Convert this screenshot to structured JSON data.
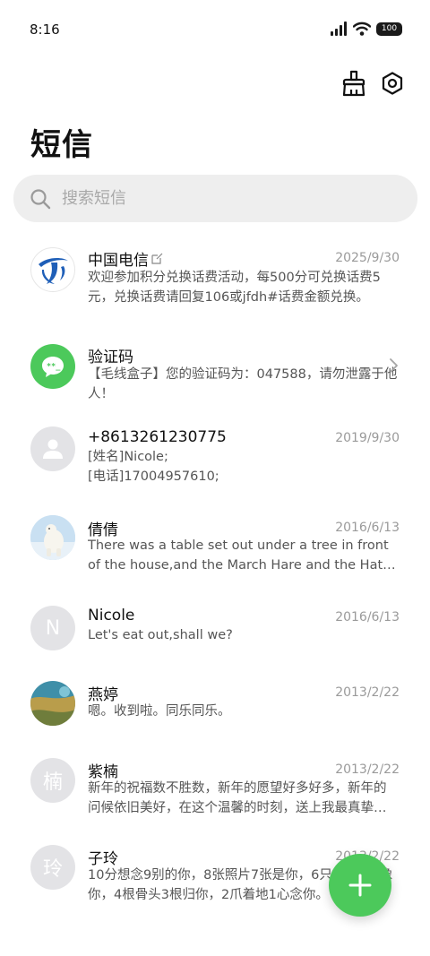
{
  "status_bar": {
    "time": "8:16",
    "battery": "100",
    "icons": [
      "signal-icon",
      "wifi-icon",
      "battery-icon"
    ]
  },
  "toolbar": {
    "icons": [
      "brush-icon",
      "settings-icon"
    ]
  },
  "page": {
    "title": "短信"
  },
  "search": {
    "placeholder": "搜索短信",
    "value": ""
  },
  "threads": [
    {
      "sender": "中国电信",
      "date": "2025/9/30",
      "preview": "欢迎参加积分兑换话费活动，每500分可兑换话费5元，兑换话费请回复106或jfdh#话费金额兑换。",
      "avatar": "china-telecom-logo"
    },
    {
      "sender": "验证码",
      "date": "",
      "preview": "【毛线盒子】您的验证码为：047588，请勿泄露于他人！",
      "avatar": "verification-code-icon"
    },
    {
      "sender": "+8613261230775",
      "date": "2019/9/30",
      "preview": "[姓名]Nicole;\n[电话]17004957610;",
      "avatar": "default-person-icon"
    },
    {
      "sender": "倩倩",
      "date": "2016/6/13",
      "preview": "There was a table set out under a tree in front of the house,and the March Hare and the Hatter were having tea at it.",
      "avatar": "polar-bear-photo"
    },
    {
      "sender": "Nicole",
      "date": "2016/6/13",
      "preview": "Let's eat out,shall we?",
      "avatar_letter": "N"
    },
    {
      "sender": "燕婷",
      "date": "2013/2/22",
      "preview": "嗯。收到啦。同乐同乐。",
      "avatar": "landscape-photo"
    },
    {
      "sender": "紫楠",
      "date": "2013/2/22",
      "preview": "新年的祝福数不胜数，新年的愿望好多好多，新年的问候依旧美好，在这个温馨的时刻，送上我最真挚的祝福。",
      "avatar_letter": "楠"
    },
    {
      "sender": "子玲",
      "date": "2013/2/22",
      "preview": "10分想念9别的你，8张照片7张是你，6只小狗5只像你，4根骨头3根归你，2爪着地1心念你。",
      "avatar_letter": "玲"
    }
  ],
  "fab": {
    "icon": "plus-icon"
  },
  "colors": {
    "accent": "#4cc95b",
    "telecom_blue": "#1f5fb8",
    "avatar_gray": "#e3e3e6"
  }
}
